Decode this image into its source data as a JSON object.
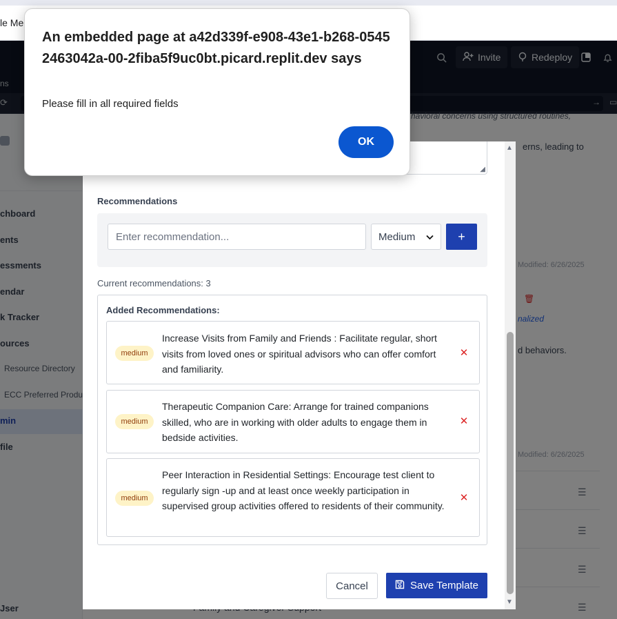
{
  "browser": {
    "tab_title": "le Me"
  },
  "header": {
    "invite_label": "Invite",
    "redeploy_label": "Redeploy"
  },
  "subbar": {
    "label": "ns"
  },
  "sidebar": {
    "items": [
      {
        "label": "chboard"
      },
      {
        "label": "ents"
      },
      {
        "label": "essments"
      },
      {
        "label": "endar"
      },
      {
        "label": "k Tracker"
      },
      {
        "label": "ources"
      },
      {
        "label": "Resource Directory"
      },
      {
        "label": "ECC Preferred Produ"
      },
      {
        "label": "min"
      },
      {
        "label": "file"
      },
      {
        "label": "Jser"
      }
    ]
  },
  "background": {
    "text_1": "havioral concerns using structured routines,",
    "text_2": "erns, leading to",
    "modified_1": "Modified: 6/26/2025",
    "link_1": "nalized",
    "text_3": "d behaviors.",
    "modified_2": "Modified: 6/26/2025",
    "bottom_item": "Family and Caregiver Support"
  },
  "modal": {
    "recommendations_label": "Recommendations",
    "input_placeholder": "Enter recommendation...",
    "priority_value": "Medium",
    "add_symbol": "+",
    "count_text": "Current recommendations: 3",
    "added_title": "Added Recommendations:",
    "recommendations": [
      {
        "priority": "medium",
        "text": "Increase Visits from Family and Friends : Facilitate regular, short visits from loved ones or spiritual advisors who can offer comfort and familiarity."
      },
      {
        "priority": "medium",
        "text": "Therapeutic Companion Care: Arrange for trained companions skilled, who are in working with older adults to engage them in bedside activities."
      },
      {
        "priority": "medium",
        "text": "Peer Interaction in Residential Settings: Encourage test client to regularly sign -up and at least once weekly participation in supervised group activities offered to residents of their community."
      }
    ],
    "cancel_label": "Cancel",
    "save_label": "Save Template"
  },
  "alert": {
    "title": "An embedded page at a42d339f-e908-43e1-b268-05452463042a-00-2fiba5f9uc0bt.picard.replit.dev says",
    "message": "Please fill in all required fields",
    "ok_label": "OK"
  }
}
